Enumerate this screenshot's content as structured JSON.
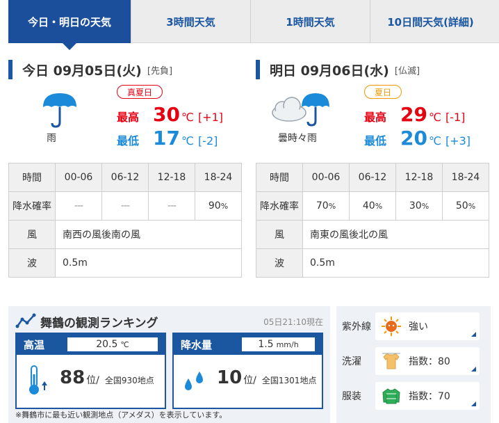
{
  "tabs": [
    {
      "label": "今日・明日の天気"
    },
    {
      "label": "3時間天気"
    },
    {
      "label": "1時間天気"
    },
    {
      "label": "10日間天気(詳細)"
    }
  ],
  "today": {
    "title": "今日 09月05日(火)",
    "rokuyo": "[先負]",
    "weather": "雨",
    "icon": "umbrella-icon",
    "badge": "真夏日",
    "high_label": "最高",
    "high": "30",
    "high_unit": "℃",
    "high_diff": "[+1]",
    "low_label": "最低",
    "low": "17",
    "low_unit": "℃",
    "low_diff": "[-2]",
    "table": {
      "time_label": "時間",
      "times": [
        "00-06",
        "06-12",
        "12-18",
        "18-24"
      ],
      "rain_label": "降水確率",
      "rain": [
        "---",
        "---",
        "---",
        "90"
      ],
      "pct": "%",
      "wind_label": "風",
      "wind": "南西の風後南の風",
      "wave_label": "波",
      "wave": "0.5m"
    }
  },
  "tomorrow": {
    "title": "明日 09月06日(水)",
    "rokuyo": "[仏滅]",
    "weather": "曇時々雨",
    "icon": "cloud-umbrella-icon",
    "badge": "夏日",
    "high_label": "最高",
    "high": "29",
    "high_unit": "℃",
    "high_diff": "[-1]",
    "low_label": "最低",
    "low": "20",
    "low_unit": "℃",
    "low_diff": "[+3]",
    "table": {
      "time_label": "時間",
      "times": [
        "00-06",
        "06-12",
        "12-18",
        "18-24"
      ],
      "rain_label": "降水確率",
      "rain": [
        "70",
        "40",
        "30",
        "50"
      ],
      "pct": "%",
      "wind_label": "風",
      "wind": "南東の風後北の風",
      "wave_label": "波",
      "wave": "0.5m"
    }
  },
  "ranking": {
    "title": "舞鶴の観測ランキング",
    "time": "05日21:10現在",
    "temp": {
      "label": "高温",
      "value": "20.5",
      "unit": "℃",
      "rank": "88",
      "rank_suffix": "位/",
      "total": "全国930地点"
    },
    "rain": {
      "label": "降水量",
      "value": "1.5",
      "unit": "mm/h",
      "rank": "10",
      "rank_suffix": "位/",
      "total": "全国1301地点"
    },
    "note": "※舞鶴市に最も近い観測地点（アメダス）を表示しています。"
  },
  "indices": [
    {
      "label": "紫外線",
      "value": "強い",
      "icon": "sun-uv-icon"
    },
    {
      "label": "洗濯",
      "value": "指数：80",
      "icon": "shirt-icon"
    },
    {
      "label": "服装",
      "value": "指数：70",
      "icon": "sweater-icon"
    }
  ],
  "colors": {
    "brand": "#1b4f9c",
    "high": "#e60012",
    "low": "#1b8ad8",
    "hot_badge": "#e60012",
    "warm_badge": "#f39800"
  }
}
